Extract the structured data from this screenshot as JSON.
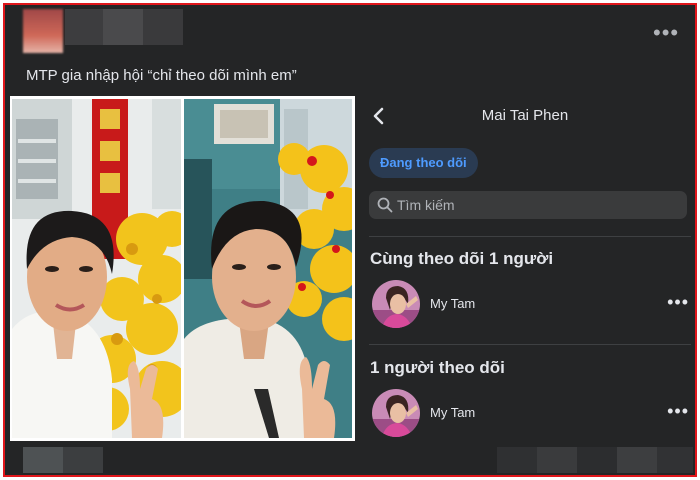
{
  "post": {
    "caption": "MTP gia nhập hội “chỉ theo dõi mình em”",
    "more_icon": "more-horizontal-icon",
    "more_glyph": "•••"
  },
  "phone_screen": {
    "title": "Mai Tai Phen",
    "back_icon": "chevron-left-icon",
    "following_button": "Đang theo dõi",
    "search": {
      "placeholder": "Tìm kiếm",
      "icon": "search-icon"
    },
    "sections": [
      {
        "title": "Cùng theo dõi 1 người",
        "users": [
          {
            "name": "My Tam",
            "more_glyph": "•••"
          }
        ]
      },
      {
        "title": "1 người theo dõi",
        "users": [
          {
            "name": "My Tam",
            "more_glyph": "•••"
          }
        ]
      }
    ]
  },
  "colors": {
    "border": "#e0161b",
    "background": "#242526",
    "text": "#e4e6eb",
    "accent": "#4e9bff"
  }
}
